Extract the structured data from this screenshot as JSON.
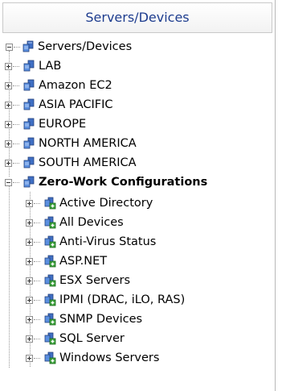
{
  "header": {
    "title": "Servers/Devices"
  },
  "root": {
    "label": "Servers/Devices",
    "expanded": true
  },
  "groups": [
    {
      "label": "LAB",
      "expanded": false
    },
    {
      "label": "Amazon EC2",
      "expanded": false
    },
    {
      "label": "ASIA PACIFIC",
      "expanded": false
    },
    {
      "label": "EUROPE",
      "expanded": false
    },
    {
      "label": "NORTH AMERICA",
      "expanded": false
    },
    {
      "label": "SOUTH AMERICA",
      "expanded": false
    },
    {
      "label": "Zero-Work Configurations",
      "expanded": true
    }
  ],
  "configurations": [
    {
      "label": "Active Directory"
    },
    {
      "label": "All Devices"
    },
    {
      "label": "Anti-Virus Status"
    },
    {
      "label": "ASP.NET"
    },
    {
      "label": "ESX Servers"
    },
    {
      "label": "IPMI (DRAC, iLO, RAS)"
    },
    {
      "label": "SNMP Devices"
    },
    {
      "label": "SQL Server"
    },
    {
      "label": "Windows Servers"
    }
  ],
  "icons": {
    "server_group": "server-group-icon",
    "config_group": "configuration-group-icon"
  },
  "colors": {
    "header_text": "#1e3d8f",
    "server_blue": "#3f6fc4",
    "config_green": "#3aa13a"
  }
}
